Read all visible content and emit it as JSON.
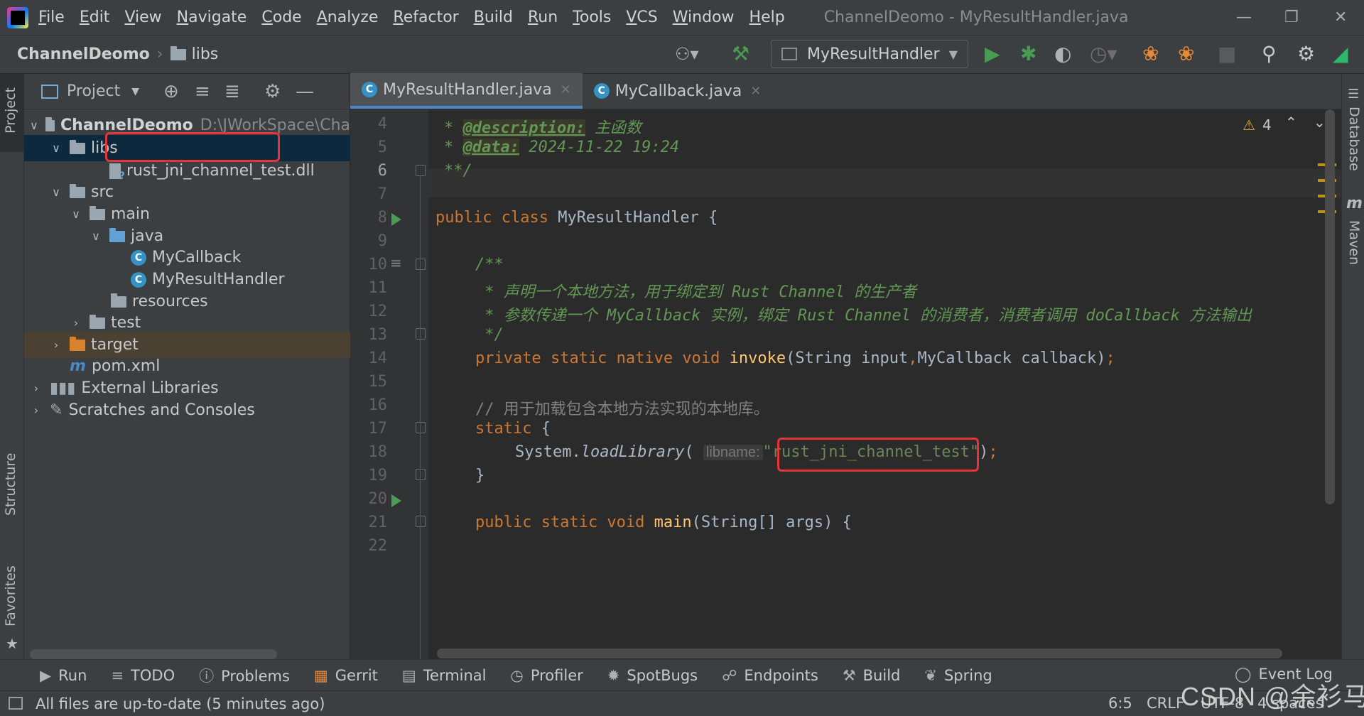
{
  "menubar": {
    "items": [
      "File",
      "Edit",
      "View",
      "Navigate",
      "Code",
      "Analyze",
      "Refactor",
      "Build",
      "Run",
      "Tools",
      "VCS",
      "Window",
      "Help"
    ],
    "window_title": "ChannelDeomo - MyResultHandler.java"
  },
  "navbar": {
    "project": "ChannelDeomo",
    "folder": "libs",
    "run_config": "MyResultHandler"
  },
  "project_panel": {
    "title": "Project",
    "tree": [
      {
        "label": "ChannelDeomo",
        "path": "D:\\JWorkSpace\\Cha"
      },
      {
        "label": "libs"
      },
      {
        "label": "rust_jni_channel_test.dll"
      },
      {
        "label": "src"
      },
      {
        "label": "main"
      },
      {
        "label": "java"
      },
      {
        "label": "MyCallback"
      },
      {
        "label": "MyResultHandler"
      },
      {
        "label": "resources"
      },
      {
        "label": "test"
      },
      {
        "label": "target"
      },
      {
        "label": "pom.xml"
      },
      {
        "label": "External Libraries"
      },
      {
        "label": "Scratches and Consoles"
      }
    ]
  },
  "side_tabs": {
    "left": [
      "Project",
      "Structure",
      "Favorites"
    ],
    "right": [
      "Database",
      "Maven"
    ]
  },
  "editor": {
    "tabs": [
      "MyResultHandler.java",
      "MyCallback.java"
    ],
    "warning_count": "4",
    "line_numbers": [
      "4",
      "5",
      "6",
      "7",
      "8",
      "9",
      "10",
      "11",
      "12",
      "13",
      "14",
      "15",
      "16",
      "17",
      "18",
      "19",
      "20",
      "21",
      "22"
    ],
    "code": {
      "l4_tag": "@description:",
      "l4_text": " 主函数",
      "l5_tag": "@data:",
      "l5_text": " 2024-11-22 19:24",
      "l6": "**/",
      "l8_kw": "public class",
      "l8_name": " MyResultHandler {",
      "l10": "/**",
      "l11": " * 声明一个本地方法，用于绑定到 Rust Channel 的生产者",
      "l12": " * 参数传递一个 MyCallback 实例，绑定 Rust Channel 的消费者，消费者调用 doCallback 方法输出",
      "l13": " */",
      "l14_kw": "private static native void ",
      "l14_fn": "invoke",
      "l14_a": "(String input",
      "l14_comma": ",",
      "l14_b": "MyCallback callback)",
      "l14_end": ";",
      "l16": "// 用于加载包含本地方法实现的本地库。",
      "l17_kw": "static",
      "l17_b": " {",
      "l18_a": "System.",
      "l18_method": "loadLibrary",
      "l18_paren": "(",
      "l18_hint": "libname:",
      "l18_str": "\"rust_jni_channel_test\"",
      "l18_close": ")",
      "l18_end": ";",
      "l19": "}",
      "l21_kw": "public static void ",
      "l21_fn": "main",
      "l21_rest": "(String[] args) {"
    }
  },
  "bottom_tabs": [
    "Run",
    "TODO",
    "Problems",
    "Gerrit",
    "Terminal",
    "Profiler",
    "SpotBugs",
    "Endpoints",
    "Build",
    "Spring",
    "Event Log"
  ],
  "status": {
    "message": "All files are up-to-date (5 minutes ago)",
    "position": "6:5",
    "line_sep": "CRLF",
    "encoding": "UTF-8",
    "indent": "4 spaces"
  },
  "watermark": "CSDN @余衫马",
  "colors": {
    "selection": "#0d293e",
    "highlight_box": "#e5343a",
    "keyword": "#cc7832",
    "string": "#6a8759",
    "doc": "#629755"
  }
}
